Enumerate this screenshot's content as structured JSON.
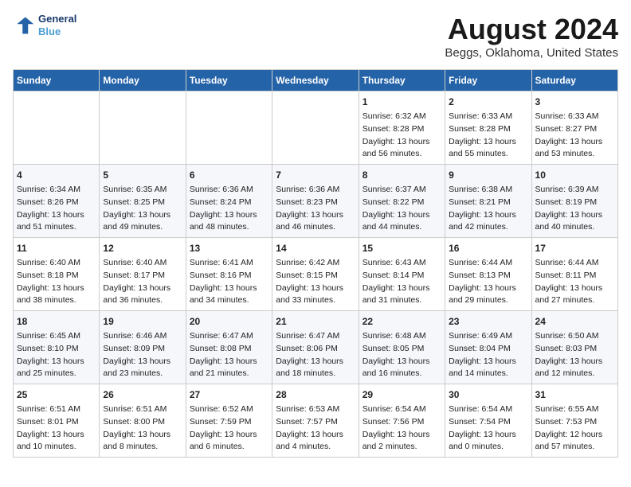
{
  "header": {
    "logo_line1": "General",
    "logo_line2": "Blue",
    "main_title": "August 2024",
    "subtitle": "Beggs, Oklahoma, United States"
  },
  "days_of_week": [
    "Sunday",
    "Monday",
    "Tuesday",
    "Wednesday",
    "Thursday",
    "Friday",
    "Saturday"
  ],
  "weeks": [
    [
      {
        "day": "",
        "info": ""
      },
      {
        "day": "",
        "info": ""
      },
      {
        "day": "",
        "info": ""
      },
      {
        "day": "",
        "info": ""
      },
      {
        "day": "1",
        "info": "Sunrise: 6:32 AM\nSunset: 8:28 PM\nDaylight: 13 hours\nand 56 minutes."
      },
      {
        "day": "2",
        "info": "Sunrise: 6:33 AM\nSunset: 8:28 PM\nDaylight: 13 hours\nand 55 minutes."
      },
      {
        "day": "3",
        "info": "Sunrise: 6:33 AM\nSunset: 8:27 PM\nDaylight: 13 hours\nand 53 minutes."
      }
    ],
    [
      {
        "day": "4",
        "info": "Sunrise: 6:34 AM\nSunset: 8:26 PM\nDaylight: 13 hours\nand 51 minutes."
      },
      {
        "day": "5",
        "info": "Sunrise: 6:35 AM\nSunset: 8:25 PM\nDaylight: 13 hours\nand 49 minutes."
      },
      {
        "day": "6",
        "info": "Sunrise: 6:36 AM\nSunset: 8:24 PM\nDaylight: 13 hours\nand 48 minutes."
      },
      {
        "day": "7",
        "info": "Sunrise: 6:36 AM\nSunset: 8:23 PM\nDaylight: 13 hours\nand 46 minutes."
      },
      {
        "day": "8",
        "info": "Sunrise: 6:37 AM\nSunset: 8:22 PM\nDaylight: 13 hours\nand 44 minutes."
      },
      {
        "day": "9",
        "info": "Sunrise: 6:38 AM\nSunset: 8:21 PM\nDaylight: 13 hours\nand 42 minutes."
      },
      {
        "day": "10",
        "info": "Sunrise: 6:39 AM\nSunset: 8:19 PM\nDaylight: 13 hours\nand 40 minutes."
      }
    ],
    [
      {
        "day": "11",
        "info": "Sunrise: 6:40 AM\nSunset: 8:18 PM\nDaylight: 13 hours\nand 38 minutes."
      },
      {
        "day": "12",
        "info": "Sunrise: 6:40 AM\nSunset: 8:17 PM\nDaylight: 13 hours\nand 36 minutes."
      },
      {
        "day": "13",
        "info": "Sunrise: 6:41 AM\nSunset: 8:16 PM\nDaylight: 13 hours\nand 34 minutes."
      },
      {
        "day": "14",
        "info": "Sunrise: 6:42 AM\nSunset: 8:15 PM\nDaylight: 13 hours\nand 33 minutes."
      },
      {
        "day": "15",
        "info": "Sunrise: 6:43 AM\nSunset: 8:14 PM\nDaylight: 13 hours\nand 31 minutes."
      },
      {
        "day": "16",
        "info": "Sunrise: 6:44 AM\nSunset: 8:13 PM\nDaylight: 13 hours\nand 29 minutes."
      },
      {
        "day": "17",
        "info": "Sunrise: 6:44 AM\nSunset: 8:11 PM\nDaylight: 13 hours\nand 27 minutes."
      }
    ],
    [
      {
        "day": "18",
        "info": "Sunrise: 6:45 AM\nSunset: 8:10 PM\nDaylight: 13 hours\nand 25 minutes."
      },
      {
        "day": "19",
        "info": "Sunrise: 6:46 AM\nSunset: 8:09 PM\nDaylight: 13 hours\nand 23 minutes."
      },
      {
        "day": "20",
        "info": "Sunrise: 6:47 AM\nSunset: 8:08 PM\nDaylight: 13 hours\nand 21 minutes."
      },
      {
        "day": "21",
        "info": "Sunrise: 6:47 AM\nSunset: 8:06 PM\nDaylight: 13 hours\nand 18 minutes."
      },
      {
        "day": "22",
        "info": "Sunrise: 6:48 AM\nSunset: 8:05 PM\nDaylight: 13 hours\nand 16 minutes."
      },
      {
        "day": "23",
        "info": "Sunrise: 6:49 AM\nSunset: 8:04 PM\nDaylight: 13 hours\nand 14 minutes."
      },
      {
        "day": "24",
        "info": "Sunrise: 6:50 AM\nSunset: 8:03 PM\nDaylight: 13 hours\nand 12 minutes."
      }
    ],
    [
      {
        "day": "25",
        "info": "Sunrise: 6:51 AM\nSunset: 8:01 PM\nDaylight: 13 hours\nand 10 minutes."
      },
      {
        "day": "26",
        "info": "Sunrise: 6:51 AM\nSunset: 8:00 PM\nDaylight: 13 hours\nand 8 minutes."
      },
      {
        "day": "27",
        "info": "Sunrise: 6:52 AM\nSunset: 7:59 PM\nDaylight: 13 hours\nand 6 minutes."
      },
      {
        "day": "28",
        "info": "Sunrise: 6:53 AM\nSunset: 7:57 PM\nDaylight: 13 hours\nand 4 minutes."
      },
      {
        "day": "29",
        "info": "Sunrise: 6:54 AM\nSunset: 7:56 PM\nDaylight: 13 hours\nand 2 minutes."
      },
      {
        "day": "30",
        "info": "Sunrise: 6:54 AM\nSunset: 7:54 PM\nDaylight: 13 hours\nand 0 minutes."
      },
      {
        "day": "31",
        "info": "Sunrise: 6:55 AM\nSunset: 7:53 PM\nDaylight: 12 hours\nand 57 minutes."
      }
    ]
  ]
}
